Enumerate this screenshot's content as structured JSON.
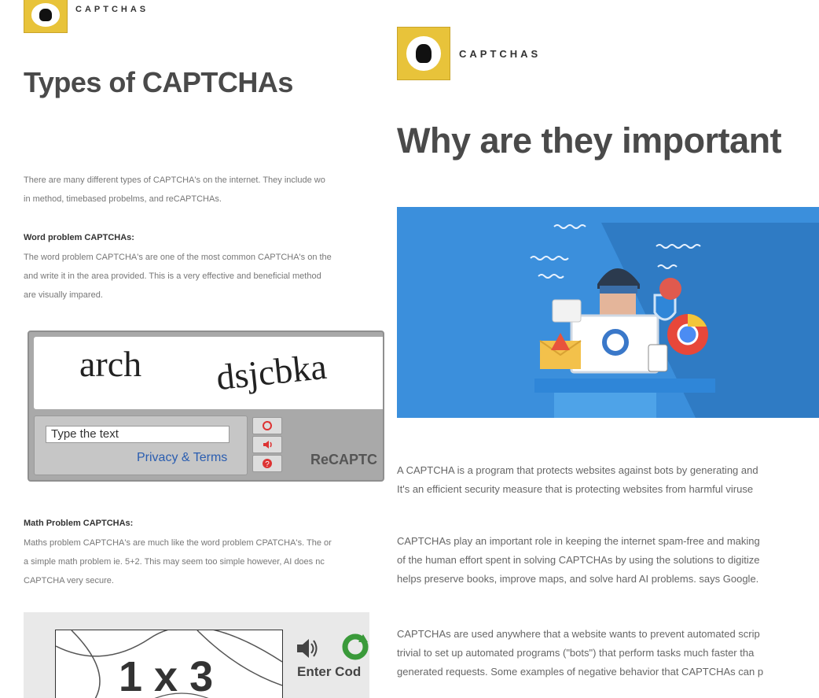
{
  "left": {
    "brand": "CAPTCHAS",
    "title": "Types of CAPTCHAs",
    "intro": [
      "There are many different types of CAPTCHA's on the internet. They include wo",
      "in method, timebased probelms, and reCAPTCHAs."
    ],
    "word_heading": "Word problem CAPTCHAs:",
    "word_text": [
      "The word problem CAPTCHA's are one of the most common CAPTCHA's on the",
      "and write it in the area provided. This is a very effective and beneficial method",
      "are visually impared."
    ],
    "recaptcha": {
      "word1": "arch",
      "word2": "dsjcbka",
      "input_placeholder": "Type the text",
      "privacy_link": "Privacy & Terms",
      "brand": "ReCAPTC"
    },
    "math_heading": "Math Problem CAPTCHAs:",
    "math_text": [
      "Maths problem CAPTCHA's are much like the word problem CPATCHA's. The or",
      "a simple math problem ie. 5+2. This may seem too simple however, AI does nc",
      "CAPTCHA very secure."
    ],
    "math_captcha": {
      "expression": "1 x 3",
      "enter_label": "Enter Cod"
    }
  },
  "right": {
    "brand": "CAPTCHAS",
    "title": "Why are they important",
    "paragraphs": [
      [
        "A CAPTCHA is a program that protects websites against bots by generating and ",
        "It's an efficient security measure that is protecting websites from harmful viruse"
      ],
      [
        "CAPTCHAs play an important role in keeping the internet spam-free and making",
        "of the human effort spent in solving CAPTCHAs by using the solutions to digitize",
        "helps preserve books, improve maps, and solve hard AI problems. says Google."
      ],
      [
        "CAPTCHAs are used anywhere that a website wants to prevent automated scrip",
        "trivial to set up automated programs (\"bots\") that perform tasks much faster tha",
        "generated requests. Some examples of negative behavior that CAPTCHAs can p"
      ]
    ]
  },
  "colors": {
    "logo_yellow": "#e8c33a",
    "hero_blue": "#3b8fdc",
    "link_blue": "#2a5db0"
  },
  "icons": [
    "robot-logo-icon",
    "refresh-icon",
    "audio-icon",
    "help-icon",
    "speaker-icon",
    "recycle-icon",
    "hacker-illustration"
  ]
}
